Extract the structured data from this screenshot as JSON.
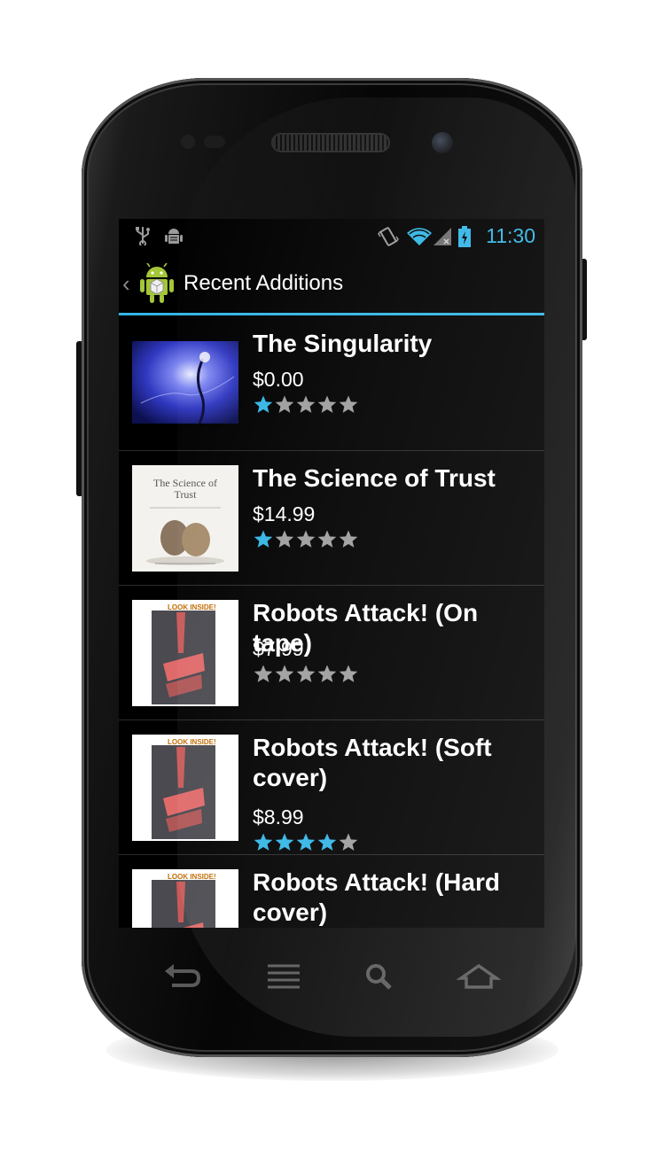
{
  "status_bar": {
    "time": "11:30",
    "left_icons": [
      "usb-icon",
      "android-debug-icon"
    ],
    "right_icons": [
      "vibrate-icon",
      "wifi-icon",
      "signal-icon",
      "battery-charging-icon"
    ]
  },
  "action_bar": {
    "title": "Recent Additions",
    "up_icon": "chevron-left-icon",
    "logo_icon": "android-logo-icon"
  },
  "colors": {
    "accent": "#33b5e5",
    "background": "#000000",
    "star_empty": "#9e9e9e",
    "star_filled": "#33b5e5"
  },
  "books": [
    {
      "title": "The Singularity",
      "price": "$0.00",
      "rating": 1,
      "max_rating": 5,
      "cover": "nebula"
    },
    {
      "title": "The Science of Trust",
      "price": "$14.99",
      "rating": 1,
      "max_rating": 5,
      "cover": "trust",
      "cover_text": "The Science of Trust"
    },
    {
      "title": "Robots Attack! (On tape)",
      "price": "$7.99",
      "rating": 0,
      "max_rating": 5,
      "cover": "robots",
      "cover_badge": "LOOK INSIDE!"
    },
    {
      "title": "Robots Attack! (Soft cover)",
      "price": "$8.99",
      "rating": 4,
      "max_rating": 5,
      "cover": "robots",
      "cover_badge": "LOOK INSIDE!"
    },
    {
      "title": "Robots Attack! (Hard cover)",
      "price": "",
      "rating": 0,
      "max_rating": 5,
      "cover": "robots",
      "cover_badge": "LOOK INSIDE!"
    }
  ],
  "nav_bar": [
    "back-icon",
    "menu-icon",
    "search-icon",
    "home-icon"
  ]
}
